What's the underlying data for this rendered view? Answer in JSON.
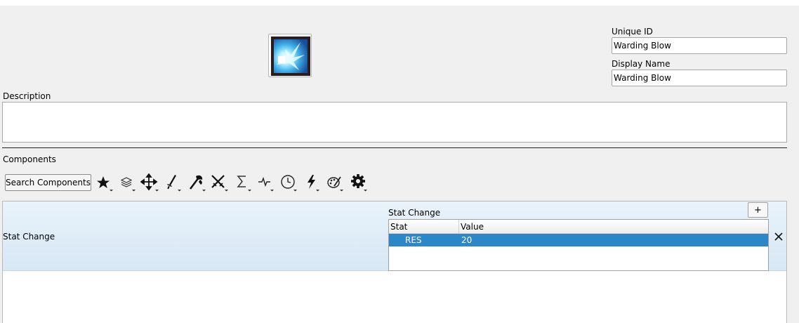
{
  "ability": {
    "icon": "ice-burst-icon",
    "unique_id_label": "Unique ID",
    "unique_id_value": "Warding Blow",
    "display_name_label": "Display Name",
    "display_name_value": "Warding Blow",
    "description_label": "Description",
    "description_value": ""
  },
  "components": {
    "label": "Components",
    "search_button": "Search Components",
    "toolbar_icons": [
      "star-icon",
      "layers-icon",
      "move-arrows-icon",
      "sword-icon",
      "axe-icon",
      "crossed-swords-icon",
      "sigma-icon",
      "pulse-icon",
      "clock-icon",
      "lightning-icon",
      "palette-icon",
      "gear-icon"
    ],
    "list": [
      {
        "name": "Stat Change",
        "section_label": "Stat Change",
        "add_button": "+",
        "remove_button": "✕",
        "table": {
          "columns": [
            "Stat",
            "Value"
          ],
          "rows": [
            {
              "stat": "RES",
              "value": "20",
              "selected": true
            }
          ]
        }
      }
    ]
  },
  "colors": {
    "background": "#f0f0f0",
    "selection": "#2d86c8",
    "component_header": "#e3eef8"
  }
}
